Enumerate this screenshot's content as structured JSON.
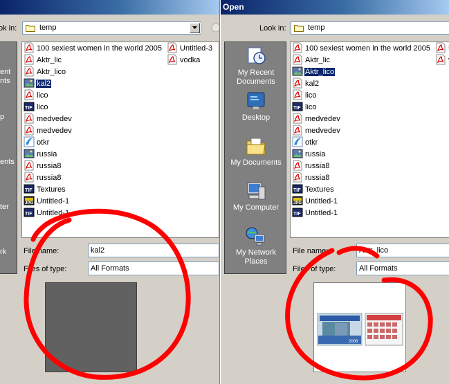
{
  "left": {
    "look_in_label": "ok in:",
    "look_in_value": "temp",
    "places": [
      {
        "label": "ent"
      },
      {
        "label": "nts"
      },
      {
        "label": "p"
      },
      {
        "label": "ents"
      },
      {
        "label": "ter"
      },
      {
        "label": "rk"
      }
    ],
    "files_col1": [
      {
        "name": "100 sexiest women in the world 2005",
        "icon": "pdf-icon"
      },
      {
        "name": "Aktr_lic",
        "icon": "pdf-icon"
      },
      {
        "name": "Aktr_lico",
        "icon": "pdf-icon"
      },
      {
        "name": "kal2",
        "icon": "image-icon"
      },
      {
        "name": "lico",
        "icon": "pdf-icon"
      },
      {
        "name": "lico",
        "icon": "tif-icon"
      },
      {
        "name": "medvedev",
        "icon": "pdf-icon"
      },
      {
        "name": "medvedev",
        "icon": "pdf-icon"
      },
      {
        "name": "otkr",
        "icon": "corel-icon"
      },
      {
        "name": "russia",
        "icon": "image-icon"
      },
      {
        "name": "russia8",
        "icon": "pdf-icon"
      },
      {
        "name": "russia8",
        "icon": "pdf-icon"
      },
      {
        "name": "Textures",
        "icon": "tif-icon"
      },
      {
        "name": "Untitled-1",
        "icon": "jpg-icon"
      },
      {
        "name": "Untitled-1",
        "icon": "tif-icon"
      }
    ],
    "files_col2": [
      {
        "name": "Untitled-3",
        "icon": "pdf-icon"
      },
      {
        "name": "vodka",
        "icon": "pdf-icon"
      }
    ],
    "file_name_label": "File name:",
    "file_name_value": "kal2",
    "file_type_label": "Files of type:",
    "file_type_value": "All Formats"
  },
  "right": {
    "title": "Open",
    "look_in_label": "Look in:",
    "look_in_value": "temp",
    "places": [
      {
        "label": "My Recent Documents",
        "icon": "recent-documents-icon"
      },
      {
        "label": "Desktop",
        "icon": "desktop-icon"
      },
      {
        "label": "My Documents",
        "icon": "my-documents-icon"
      },
      {
        "label": "My Computer",
        "icon": "my-computer-icon"
      },
      {
        "label": "My Network Places",
        "icon": "network-places-icon"
      }
    ],
    "files_col1": [
      {
        "name": "100 sexiest women in the world 2005",
        "icon": "pdf-icon"
      },
      {
        "name": "Aktr_lic",
        "icon": "pdf-icon"
      },
      {
        "name": "Aktr_lico",
        "icon": "image-icon"
      },
      {
        "name": "kal2",
        "icon": "pdf-icon"
      },
      {
        "name": "lico",
        "icon": "pdf-icon"
      },
      {
        "name": "lico",
        "icon": "tif-icon"
      },
      {
        "name": "medvedev",
        "icon": "pdf-icon"
      },
      {
        "name": "medvedev",
        "icon": "pdf-icon"
      },
      {
        "name": "otkr",
        "icon": "corel-icon"
      },
      {
        "name": "russia",
        "icon": "image-icon"
      },
      {
        "name": "russia8",
        "icon": "pdf-icon"
      },
      {
        "name": "russia8",
        "icon": "pdf-icon"
      },
      {
        "name": "Textures",
        "icon": "tif-icon"
      },
      {
        "name": "Untitled-1",
        "icon": "jpg-icon"
      },
      {
        "name": "Untitled-1",
        "icon": "tif-icon"
      }
    ],
    "files_col2": [
      {
        "name": "U",
        "icon": "pdf-icon"
      },
      {
        "name": "v",
        "icon": "pdf-icon"
      }
    ],
    "file_name_label": "File name:",
    "file_name_value": "Aktr_lico",
    "file_type_label": "Files of type:",
    "file_type_value": "All Formats"
  },
  "preview_thumb": {
    "badge_text": "2006"
  },
  "colors": {
    "titlebar": "#0a246a",
    "face": "#d4d0c8",
    "places_bg": "#808080",
    "selection": "#0a246a",
    "annotation": "#ff0000"
  }
}
